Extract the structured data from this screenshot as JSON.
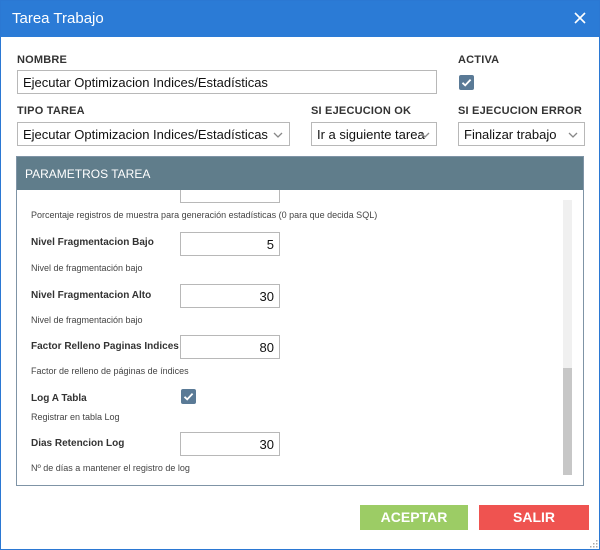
{
  "window": {
    "title": "Tarea Trabajo"
  },
  "form": {
    "nombre_label": "NOMBRE",
    "nombre_value": "Ejecutar Optimizacion Indices/Estadísticas",
    "activa_label": "ACTIVA",
    "activa_checked": true,
    "tipo_label": "TIPO TAREA",
    "tipo_value": "Ejecutar Optimizacion Indices/Estadísticas",
    "ok_label": "SI EJECUCION OK",
    "ok_value": "Ir a siguiente tarea",
    "error_label": "SI EJECUCION ERROR",
    "error_value": "Finalizar trabajo"
  },
  "params": {
    "title": "PARAMETROS TAREA",
    "top_desc": "Porcentaje registros de muestra para generación estadísticas (0 para que decida SQL)",
    "items": [
      {
        "label": "Nivel Fragmentacion Bajo",
        "value": "5",
        "desc": "Nivel de fragmentación bajo"
      },
      {
        "label": "Nivel Fragmentacion Alto",
        "value": "30",
        "desc": "Nivel de fragmentación bajo"
      },
      {
        "label": "Factor Relleno Paginas Indices",
        "value": "80",
        "desc": "Factor de relleno de páginas de índices"
      },
      {
        "label": "Log A Tabla",
        "checked": true,
        "desc": "Registrar en tabla Log"
      },
      {
        "label": "Dias Retencion Log",
        "value": "30",
        "desc": "Nº de días a mantener el registro de log"
      }
    ]
  },
  "buttons": {
    "accept": "ACEPTAR",
    "exit": "SALIR"
  },
  "colors": {
    "titlebar": "#2b7bd6",
    "panel_header": "#607d8b",
    "accept": "#9ccc65",
    "exit": "#ef5350",
    "checkbox": "#5a7a96"
  },
  "icons": {
    "close": "close-icon",
    "dropdown": "chevron-down-icon",
    "check": "check-icon"
  }
}
